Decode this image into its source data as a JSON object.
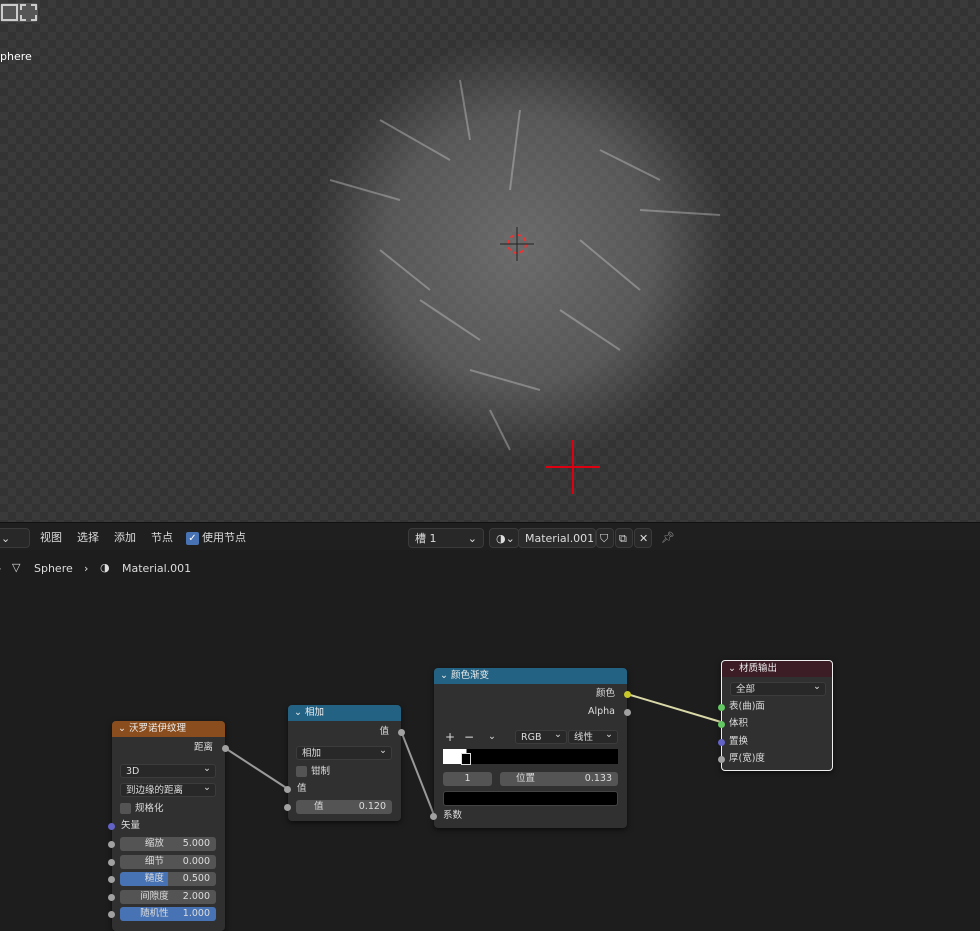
{
  "viewport": {
    "object_label": "phere"
  },
  "header": {
    "menu": [
      "视图",
      "选择",
      "添加",
      "节点"
    ],
    "use_nodes_label": "使用节点",
    "use_nodes": true,
    "slot": "槽 1",
    "material": "Material.001"
  },
  "breadcrumb": {
    "object": "Sphere",
    "material": "Material.001"
  },
  "nodes": {
    "voronoi": {
      "title": "沃罗诺伊纹理",
      "output": "距离",
      "dim": "3D",
      "feature": "到边缘的距离",
      "normalize": "规格化",
      "vector": "矢量",
      "fields": [
        {
          "label": "缩放",
          "value": "5.000",
          "fill": 0
        },
        {
          "label": "细节",
          "value": "0.000",
          "fill": 0
        },
        {
          "label": "糙度",
          "value": "0.500",
          "fill": 0.5
        },
        {
          "label": "间隙度",
          "value": "2.000",
          "fill": 0
        },
        {
          "label": "随机性",
          "value": "1.000",
          "fill": 1
        }
      ]
    },
    "math": {
      "title": "相加",
      "output": "值",
      "operation": "相加",
      "clamp": "钳制",
      "input1": "值",
      "input2_label": "值",
      "input2_value": "0.120"
    },
    "ramp": {
      "title": "颜色渐变",
      "out_color": "颜色",
      "out_alpha": "Alpha",
      "plus": "+",
      "minus": "−",
      "menu": "⌄",
      "mode": "RGB",
      "interp": "线性",
      "index": "1",
      "pos_label": "位置",
      "pos_value": "0.133",
      "input": "系数"
    },
    "output": {
      "title": "材质输出",
      "target": "全部",
      "surface": "表(曲)面",
      "volume": "体积",
      "displacement": "置换",
      "thickness": "厚(宽)度"
    }
  }
}
